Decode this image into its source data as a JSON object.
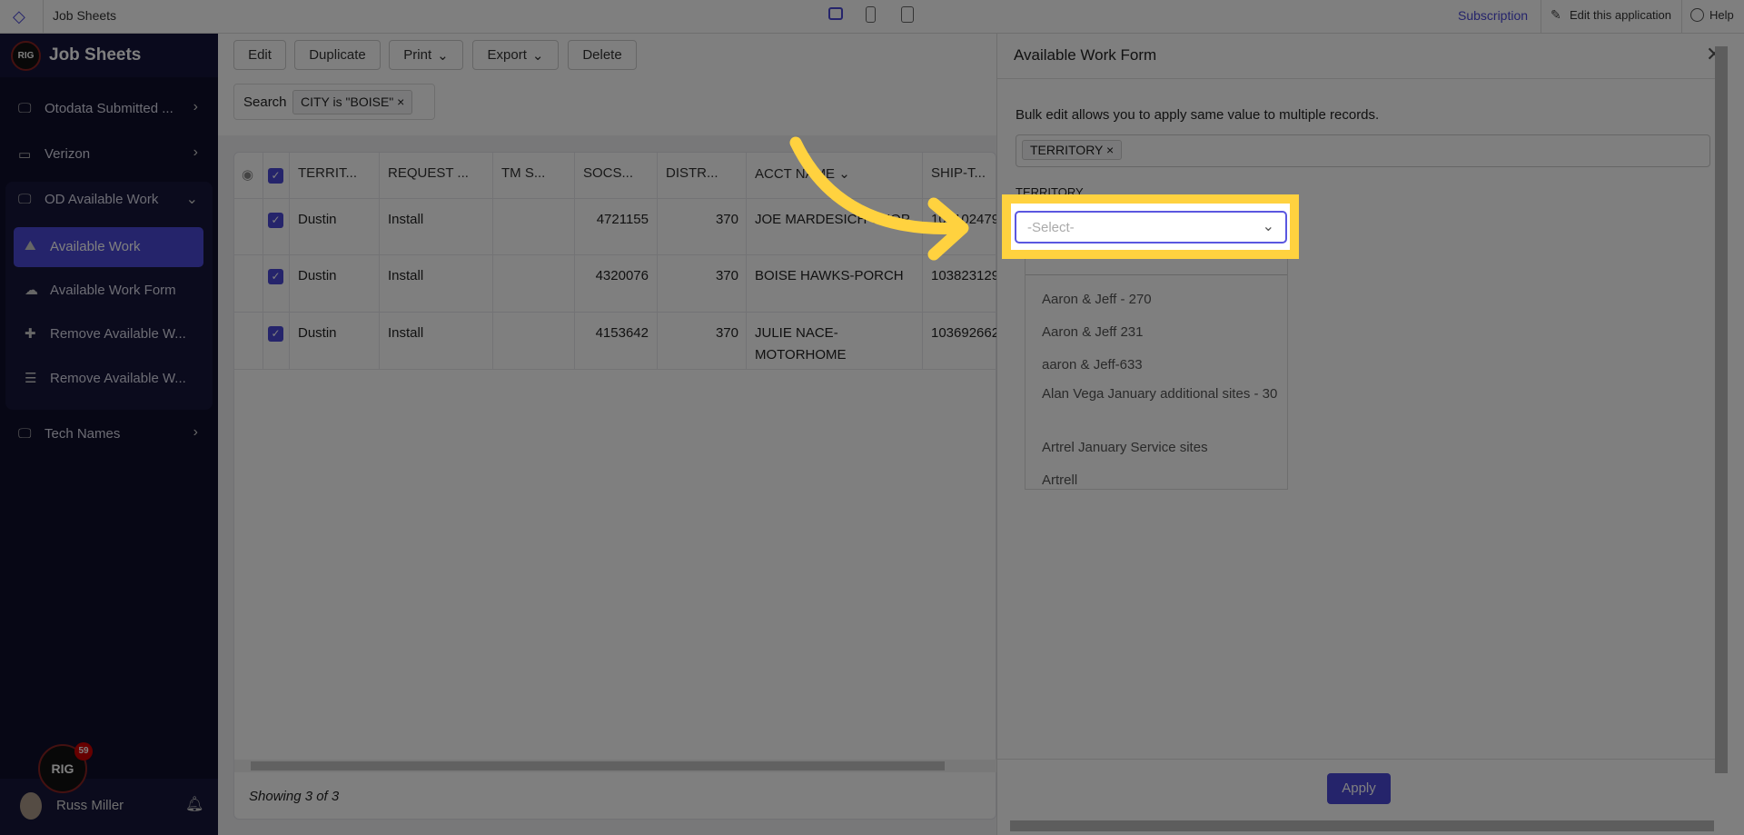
{
  "topbar": {
    "title": "Job Sheets",
    "subscription": "Subscription",
    "edit_app": "Edit this application",
    "help": "Help",
    "device_icons": [
      "desktop-icon",
      "tablet-icon",
      "mobile-icon"
    ]
  },
  "sidebar": {
    "app_name": "Job Sheets",
    "logo_text": "RIG",
    "items": [
      {
        "label": "Otodata Submitted ...",
        "icon": "monitor-icon"
      },
      {
        "label": "Verizon",
        "icon": "cast-icon"
      },
      {
        "label": "OD Available Work",
        "icon": "monitor-icon"
      },
      {
        "label": "Tech Names",
        "icon": "monitor-icon"
      }
    ],
    "subitems": [
      {
        "label": "Available Work",
        "icon": "chart-icon",
        "active": true
      },
      {
        "label": "Available Work Form",
        "icon": "upload-cloud-icon"
      },
      {
        "label": "Remove Available W...",
        "icon": "plus-icon"
      },
      {
        "label": "Remove Available W...",
        "icon": "list-icon"
      }
    ],
    "notification_count": "59",
    "user_name": "Russ Miller"
  },
  "toolbar": {
    "edit": "Edit",
    "duplicate": "Duplicate",
    "print": "Print",
    "export": "Export",
    "delete": "Delete"
  },
  "search": {
    "label": "Search",
    "filter": "CITY is \"BOISE\""
  },
  "table": {
    "columns": [
      "TERRIT...",
      "REQUEST ...",
      "TM S...",
      "SOCS...",
      "DISTR...",
      "ACCT NAME",
      "SHIP-T..."
    ],
    "rows": [
      {
        "territ": "Dustin",
        "request": "Install",
        "tms": "",
        "socs": "4721155",
        "distr": "370",
        "acct": "JOE MARDESICH-SHOP",
        "ship": "104102479"
      },
      {
        "territ": "Dustin",
        "request": "Install",
        "tms": "",
        "socs": "4320076",
        "distr": "370",
        "acct": "BOISE HAWKS-PORCH",
        "ship": "103823129"
      },
      {
        "territ": "Dustin",
        "request": "Install",
        "tms": "",
        "socs": "4153642",
        "distr": "370",
        "acct": "JULIE NACE-MOTORHOME",
        "ship": "103692662"
      }
    ],
    "footer": "Showing 3 of 3"
  },
  "panel": {
    "title": "Available Work Form",
    "description": "Bulk edit allows you to apply same value to multiple records.",
    "field_tag": "TERRITORY",
    "field_label": "TERRITORY",
    "select_placeholder": "-Select-",
    "options": [
      "Aaron & Jeff - 270",
      "Aaron & Jeff 231",
      "aaron & Jeff-633",
      "Alan Vega January additional sites - 30",
      "Artrel January Service sites",
      "Artrell"
    ],
    "apply": "Apply"
  },
  "colors": {
    "accent": "#4b48d6",
    "highlight": "#ffd23f",
    "sidebar": "#0f0e2a"
  }
}
